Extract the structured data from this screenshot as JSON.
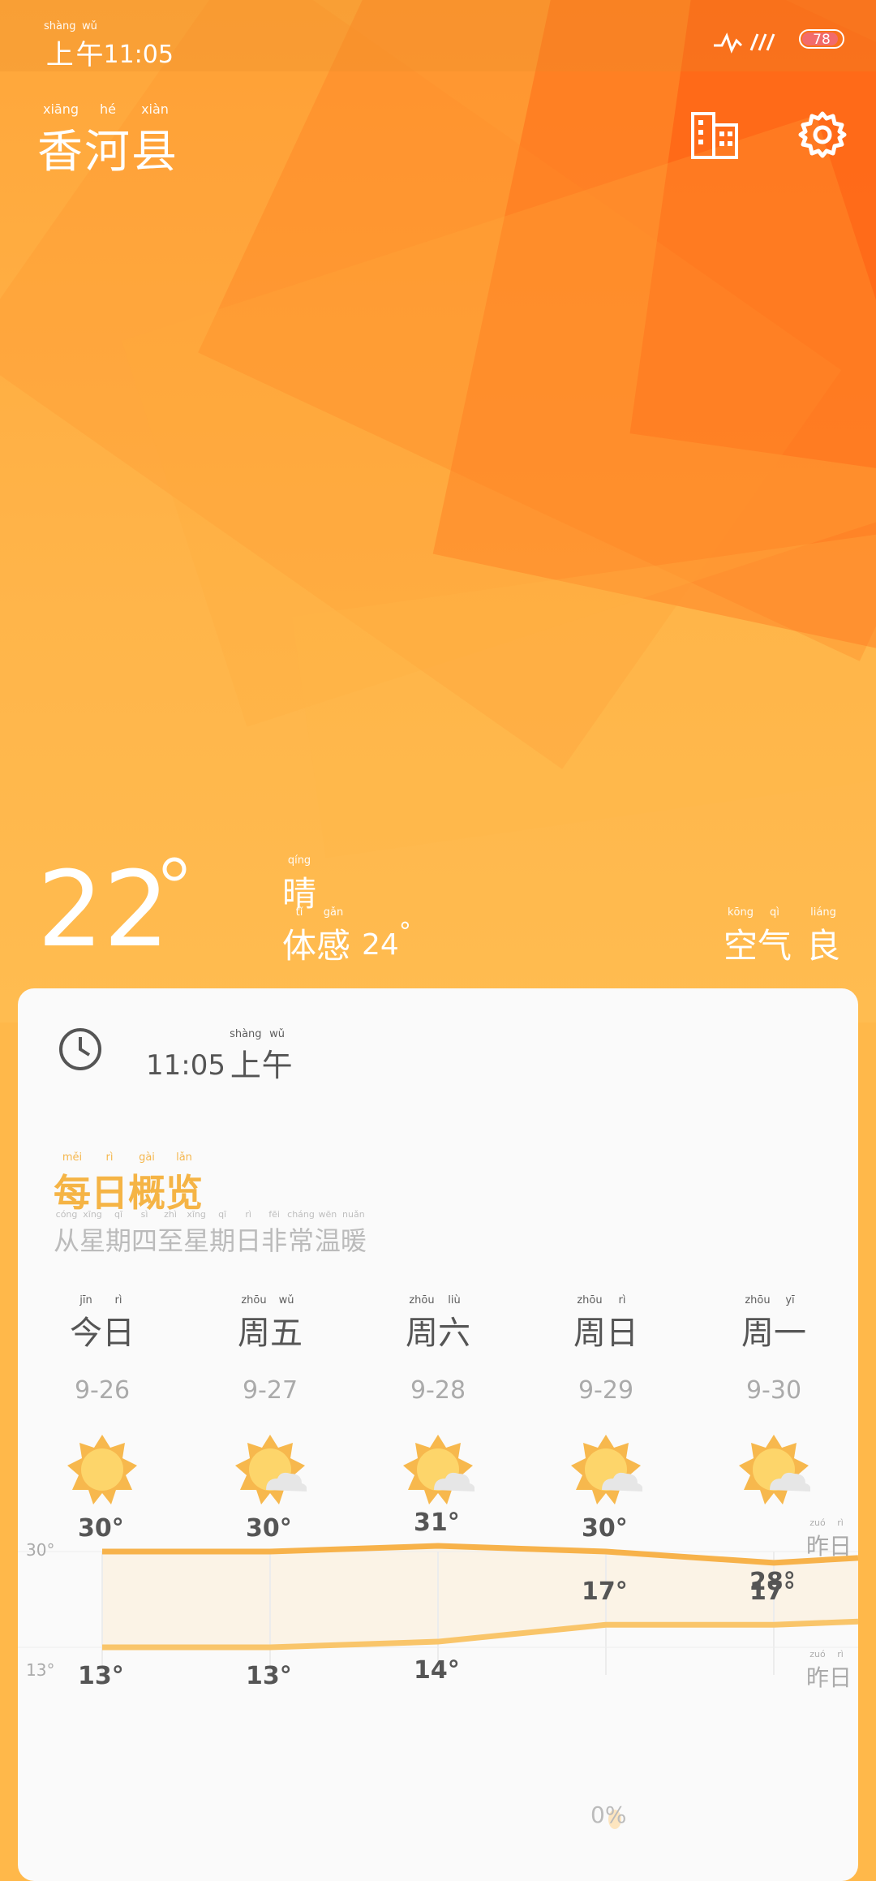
{
  "status_bar": {
    "ampm": "上午",
    "ampm_pinyin": [
      "shàng",
      "wǔ"
    ],
    "time": "11:05",
    "battery": "78"
  },
  "header": {
    "city": "香河县",
    "city_pinyin": [
      "xiāng",
      "hé",
      "xiàn"
    ],
    "city_icon": "building-icon",
    "settings_icon": "gear-icon"
  },
  "current": {
    "temperature": "22",
    "condition": "晴",
    "condition_pinyin": "qíng",
    "feels_label": "体感",
    "feels_pinyin": [
      "tǐ",
      "gǎn"
    ],
    "feels_value": "24",
    "air_label": "空气",
    "air_pinyin": [
      "kōng",
      "qì"
    ],
    "air_value": "良",
    "air_value_pinyin": "liáng"
  },
  "card": {
    "clock_icon": "clock-icon",
    "time": "11:05",
    "ampm": "上午",
    "ampm_pinyin": [
      "shàng",
      "wǔ"
    ],
    "summary_title": "每日概览",
    "summary_title_pinyin": [
      "měi",
      "rì",
      "gài",
      "lǎn"
    ],
    "summary_desc": "从星期四至星期日非常温暖",
    "summary_desc_pinyin": [
      "cóng",
      "xīng",
      "qī",
      "sì",
      "zhì",
      "xīng",
      "qī",
      "rì",
      "fēi",
      "cháng",
      "wēn",
      "nuǎn"
    ]
  },
  "forecast": [
    {
      "day": "今日",
      "pinyin": [
        "jīn",
        "rì"
      ],
      "date": "9-26",
      "icon": "sun-icon",
      "high": "30",
      "low": "13"
    },
    {
      "day": "周五",
      "pinyin": [
        "zhōu",
        "wǔ"
      ],
      "date": "9-27",
      "icon": "sun-cloud-icon",
      "high": "30",
      "low": "13"
    },
    {
      "day": "周六",
      "pinyin": [
        "zhōu",
        "liù"
      ],
      "date": "9-28",
      "icon": "sun-cloud-icon",
      "high": "31",
      "low": "14"
    },
    {
      "day": "周日",
      "pinyin": [
        "zhōu",
        "rì"
      ],
      "date": "9-29",
      "icon": "sun-cloud-icon",
      "high": "30",
      "low": "17"
    },
    {
      "day": "周一",
      "pinyin": [
        "zhōu",
        "yī"
      ],
      "date": "9-30",
      "icon": "sun-cloud-icon",
      "high": "28",
      "low": "17"
    }
  ],
  "chart_axis": {
    "top": "30",
    "bottom": "13",
    "yesterday": "昨日",
    "yesterday_pinyin": [
      "zuó",
      "rì"
    ]
  },
  "precip_label": "0%",
  "colors": {
    "accent": "#f5b445",
    "high_line": "#f7b24a",
    "low_line": "#f9c56a"
  }
}
